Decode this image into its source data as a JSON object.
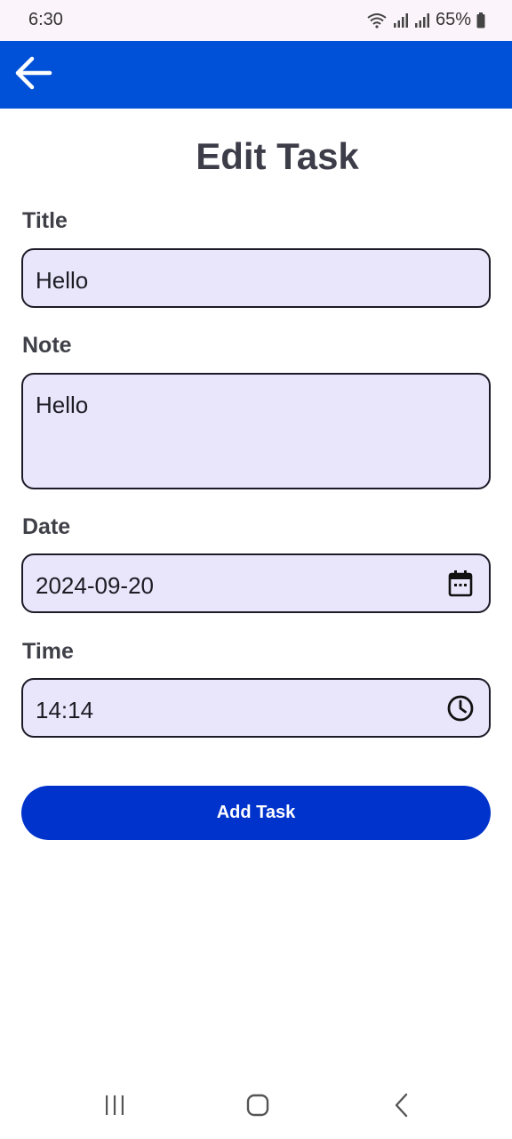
{
  "status_bar": {
    "time": "6:30",
    "battery": "65%"
  },
  "page": {
    "title": "Edit Task"
  },
  "form": {
    "title_label": "Title",
    "title_value": "Hello",
    "note_label": "Note",
    "note_value": "Hello",
    "date_label": "Date",
    "date_value": "2024-09-20",
    "time_label": "Time",
    "time_value": "14:14",
    "submit_label": "Add Task"
  },
  "icons": {
    "back": "arrow-left-icon",
    "date": "calendar-icon",
    "time": "clock-icon",
    "nav_recents": "recents-icon",
    "nav_home": "home-icon",
    "nav_back": "chevron-left-icon"
  },
  "colors": {
    "app_bar": "#0050d8",
    "button": "#0033cc",
    "field_background": "#e9e6fb"
  }
}
